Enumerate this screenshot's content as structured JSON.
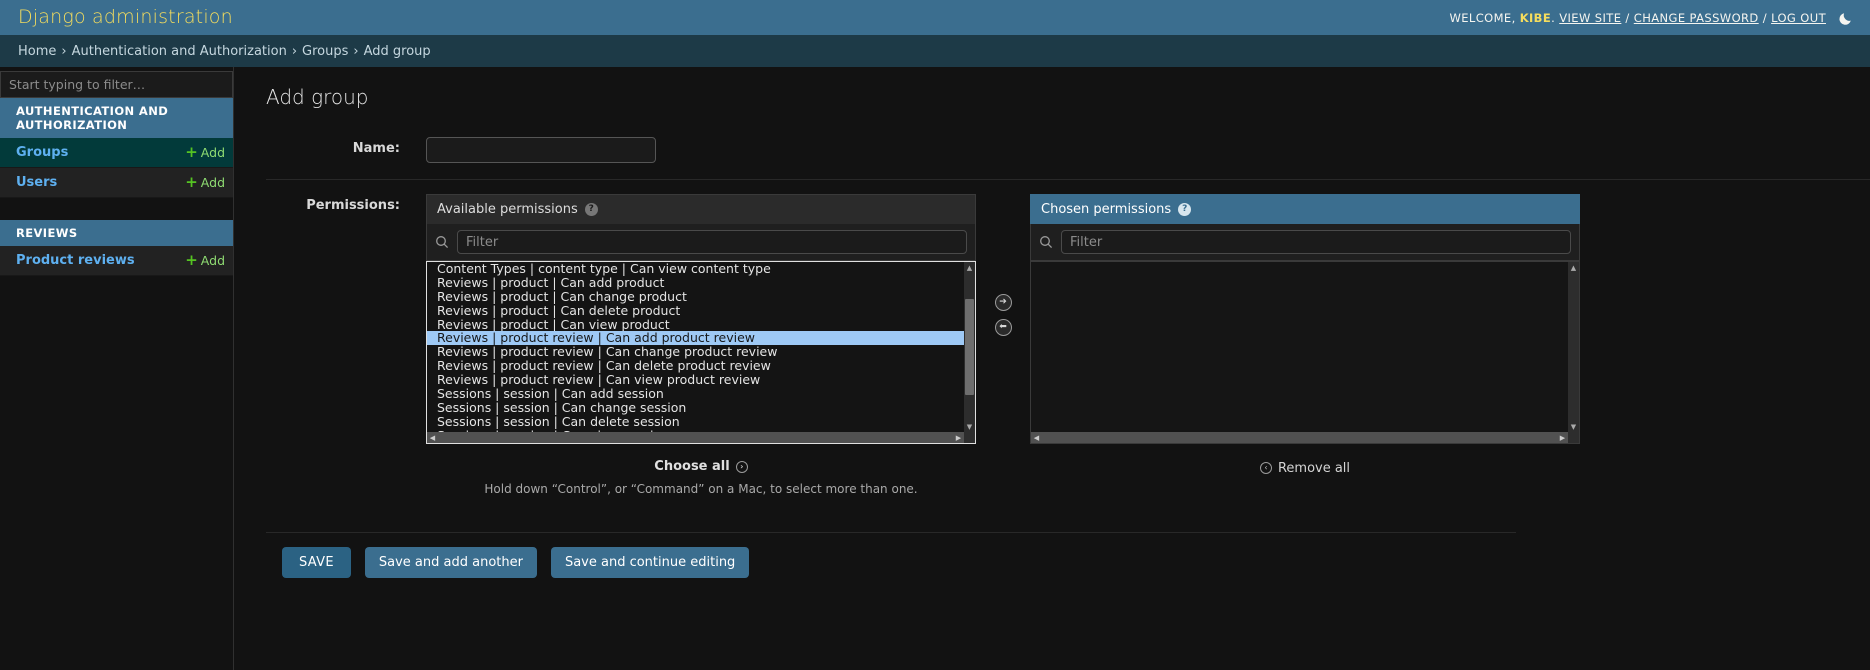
{
  "header": {
    "site_name": "Django administration",
    "welcome_prefix": "WELCOME, ",
    "username": "KIBE",
    "welcome_suffix": ".",
    "view_site": "VIEW SITE",
    "sep1": " / ",
    "change_password": "CHANGE PASSWORD",
    "sep2": " / ",
    "log_out": "LOG OUT",
    "theme_icon": "moon-icon",
    "brand_color": "#f5dd5d",
    "header_bg": "#3b6e8f"
  },
  "breadcrumbs": {
    "home": "Home",
    "app": "Authentication and Authorization",
    "model": "Groups",
    "current": "Add group",
    "separator": "›"
  },
  "sidebar": {
    "filter_placeholder": "Start typing to filter…",
    "apps": [
      {
        "caption": "AUTHENTICATION AND AUTHORIZATION",
        "models": [
          {
            "label": "Groups",
            "add_label": "Add",
            "current": true
          },
          {
            "label": "Users",
            "add_label": "Add",
            "current": false
          }
        ]
      },
      {
        "caption": "REVIEWS",
        "models": [
          {
            "label": "Product reviews",
            "add_label": "Add",
            "current": false
          }
        ]
      }
    ]
  },
  "main": {
    "title": "Add group",
    "name_label": "Name:",
    "name_value": "",
    "permissions_label": "Permissions:",
    "available": {
      "heading": "Available permissions",
      "help_icon": "question-mark-icon",
      "filter_placeholder": "Filter",
      "filter_value": "",
      "items": [
        {
          "label": "Content Types | content type | Can view content type",
          "selected": false,
          "clipped": true
        },
        {
          "label": "Reviews | product | Can add product",
          "selected": false
        },
        {
          "label": "Reviews | product | Can change product",
          "selected": false
        },
        {
          "label": "Reviews | product | Can delete product",
          "selected": false
        },
        {
          "label": "Reviews | product | Can view product",
          "selected": false
        },
        {
          "label": "Reviews | product review | Can add product review",
          "selected": true
        },
        {
          "label": "Reviews | product review | Can change product review",
          "selected": false
        },
        {
          "label": "Reviews | product review | Can delete product review",
          "selected": false
        },
        {
          "label": "Reviews | product review | Can view product review",
          "selected": false
        },
        {
          "label": "Sessions | session | Can add session",
          "selected": false
        },
        {
          "label": "Sessions | session | Can change session",
          "selected": false
        },
        {
          "label": "Sessions | session | Can delete session",
          "selected": false
        },
        {
          "label": "Sessions | session | Can view session",
          "selected": false
        }
      ],
      "choose_all_label": "Choose all",
      "help_text": "Hold down “Control”, or “Command” on a Mac, to select more than one."
    },
    "chosen": {
      "heading": "Chosen permissions",
      "help_icon": "question-mark-icon",
      "filter_placeholder": "Filter",
      "filter_value": "",
      "items": [],
      "remove_all_label": "Remove all"
    },
    "chooser": {
      "add_icon": "arrow-right-icon",
      "remove_icon": "arrow-left-icon"
    }
  },
  "submit_row": {
    "save": "SAVE",
    "save_and_add_another": "Save and add another",
    "save_and_continue": "Save and continue editing"
  }
}
